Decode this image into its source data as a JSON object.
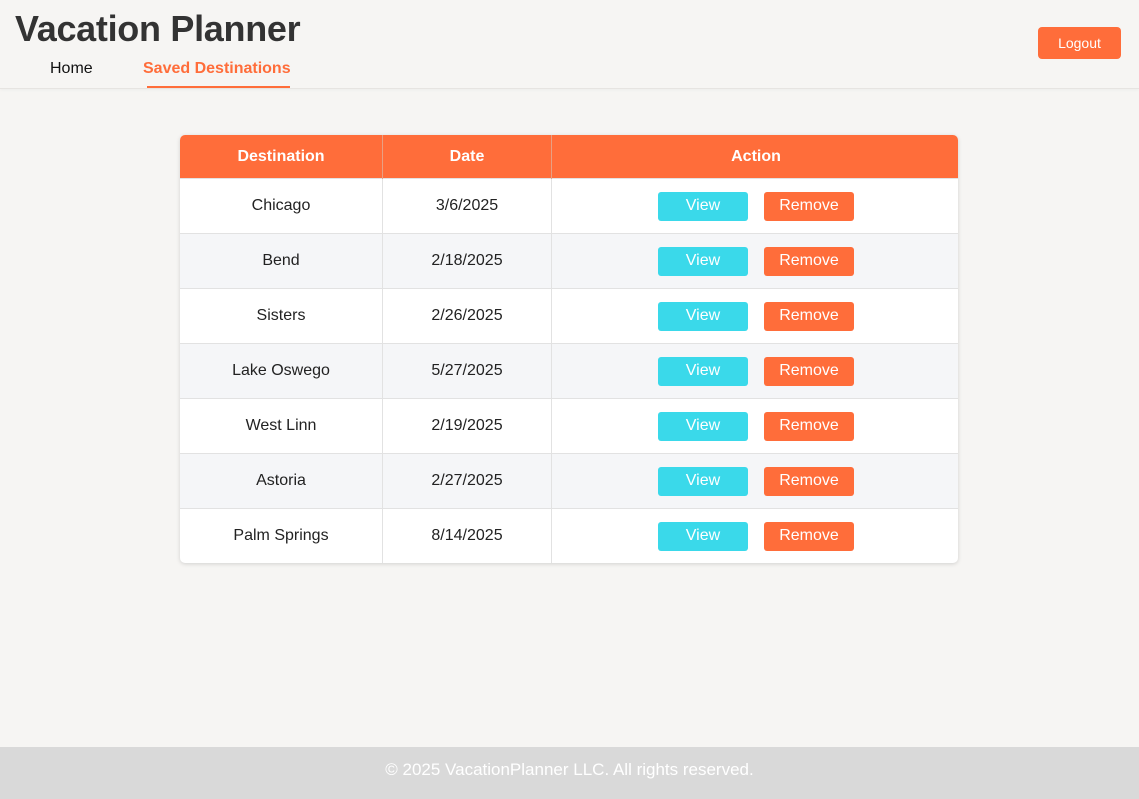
{
  "header": {
    "title": "Vacation Planner",
    "nav": {
      "home_label": "Home",
      "saved_label": "Saved Destinations",
      "active": "Saved Destinations"
    },
    "logout_label": "Logout"
  },
  "table": {
    "columns": [
      "Destination",
      "Date",
      "Action"
    ],
    "rows": [
      {
        "destination": "Chicago",
        "date": "3/6/2025"
      },
      {
        "destination": "Bend",
        "date": "2/18/2025"
      },
      {
        "destination": "Sisters",
        "date": "2/26/2025"
      },
      {
        "destination": "Lake Oswego",
        "date": "5/27/2025"
      },
      {
        "destination": "West Linn",
        "date": "2/19/2025"
      },
      {
        "destination": "Astoria",
        "date": "2/27/2025"
      },
      {
        "destination": "Palm Springs",
        "date": "8/14/2025"
      }
    ],
    "view_label": "View",
    "remove_label": "Remove"
  },
  "footer": {
    "text": "© 2025 VacationPlanner LLC. All rights reserved."
  },
  "colors": {
    "accent": "#ff6d3a",
    "view_button": "#3ad9ea",
    "background": "#f6f5f3",
    "footer_background": "#d9d9d9"
  }
}
